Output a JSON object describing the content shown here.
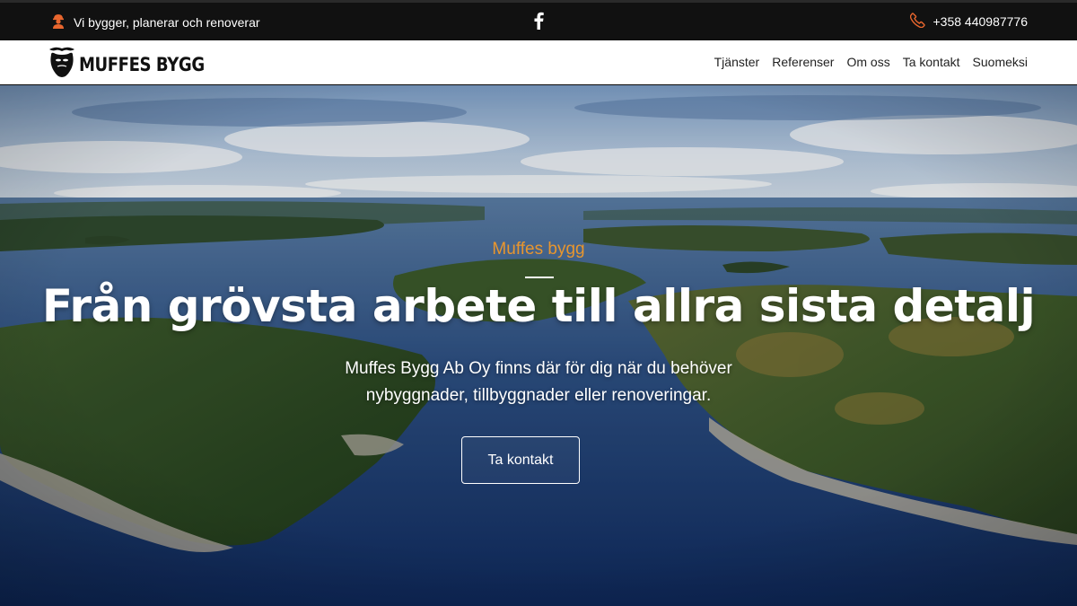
{
  "topbar": {
    "tagline": "Vi bygger, planerar och renoverar",
    "tagline_icon": "worker-icon",
    "social_icon": "facebook-icon",
    "phone": "+358 440987776",
    "phone_icon": "phone-icon",
    "accent_color": "#e8662e"
  },
  "header": {
    "logo_text": "MUFFES BYGG",
    "logo_icon": "bearded-face-icon",
    "nav": [
      {
        "label": "Tjänster"
      },
      {
        "label": "Referenser"
      },
      {
        "label": "Om oss"
      },
      {
        "label": "Ta kontakt"
      },
      {
        "label": "Suomeksi"
      }
    ]
  },
  "hero": {
    "kicker": "Muffes bygg",
    "title": "Från grövsta arbete till allra sista detalj",
    "subtitle": "Muffes Bygg Ab Oy finns där för dig när du behöver nybyggnader, tillbyggnader eller renoveringar.",
    "cta_label": "Ta kontakt",
    "kicker_color": "#e8962e"
  }
}
